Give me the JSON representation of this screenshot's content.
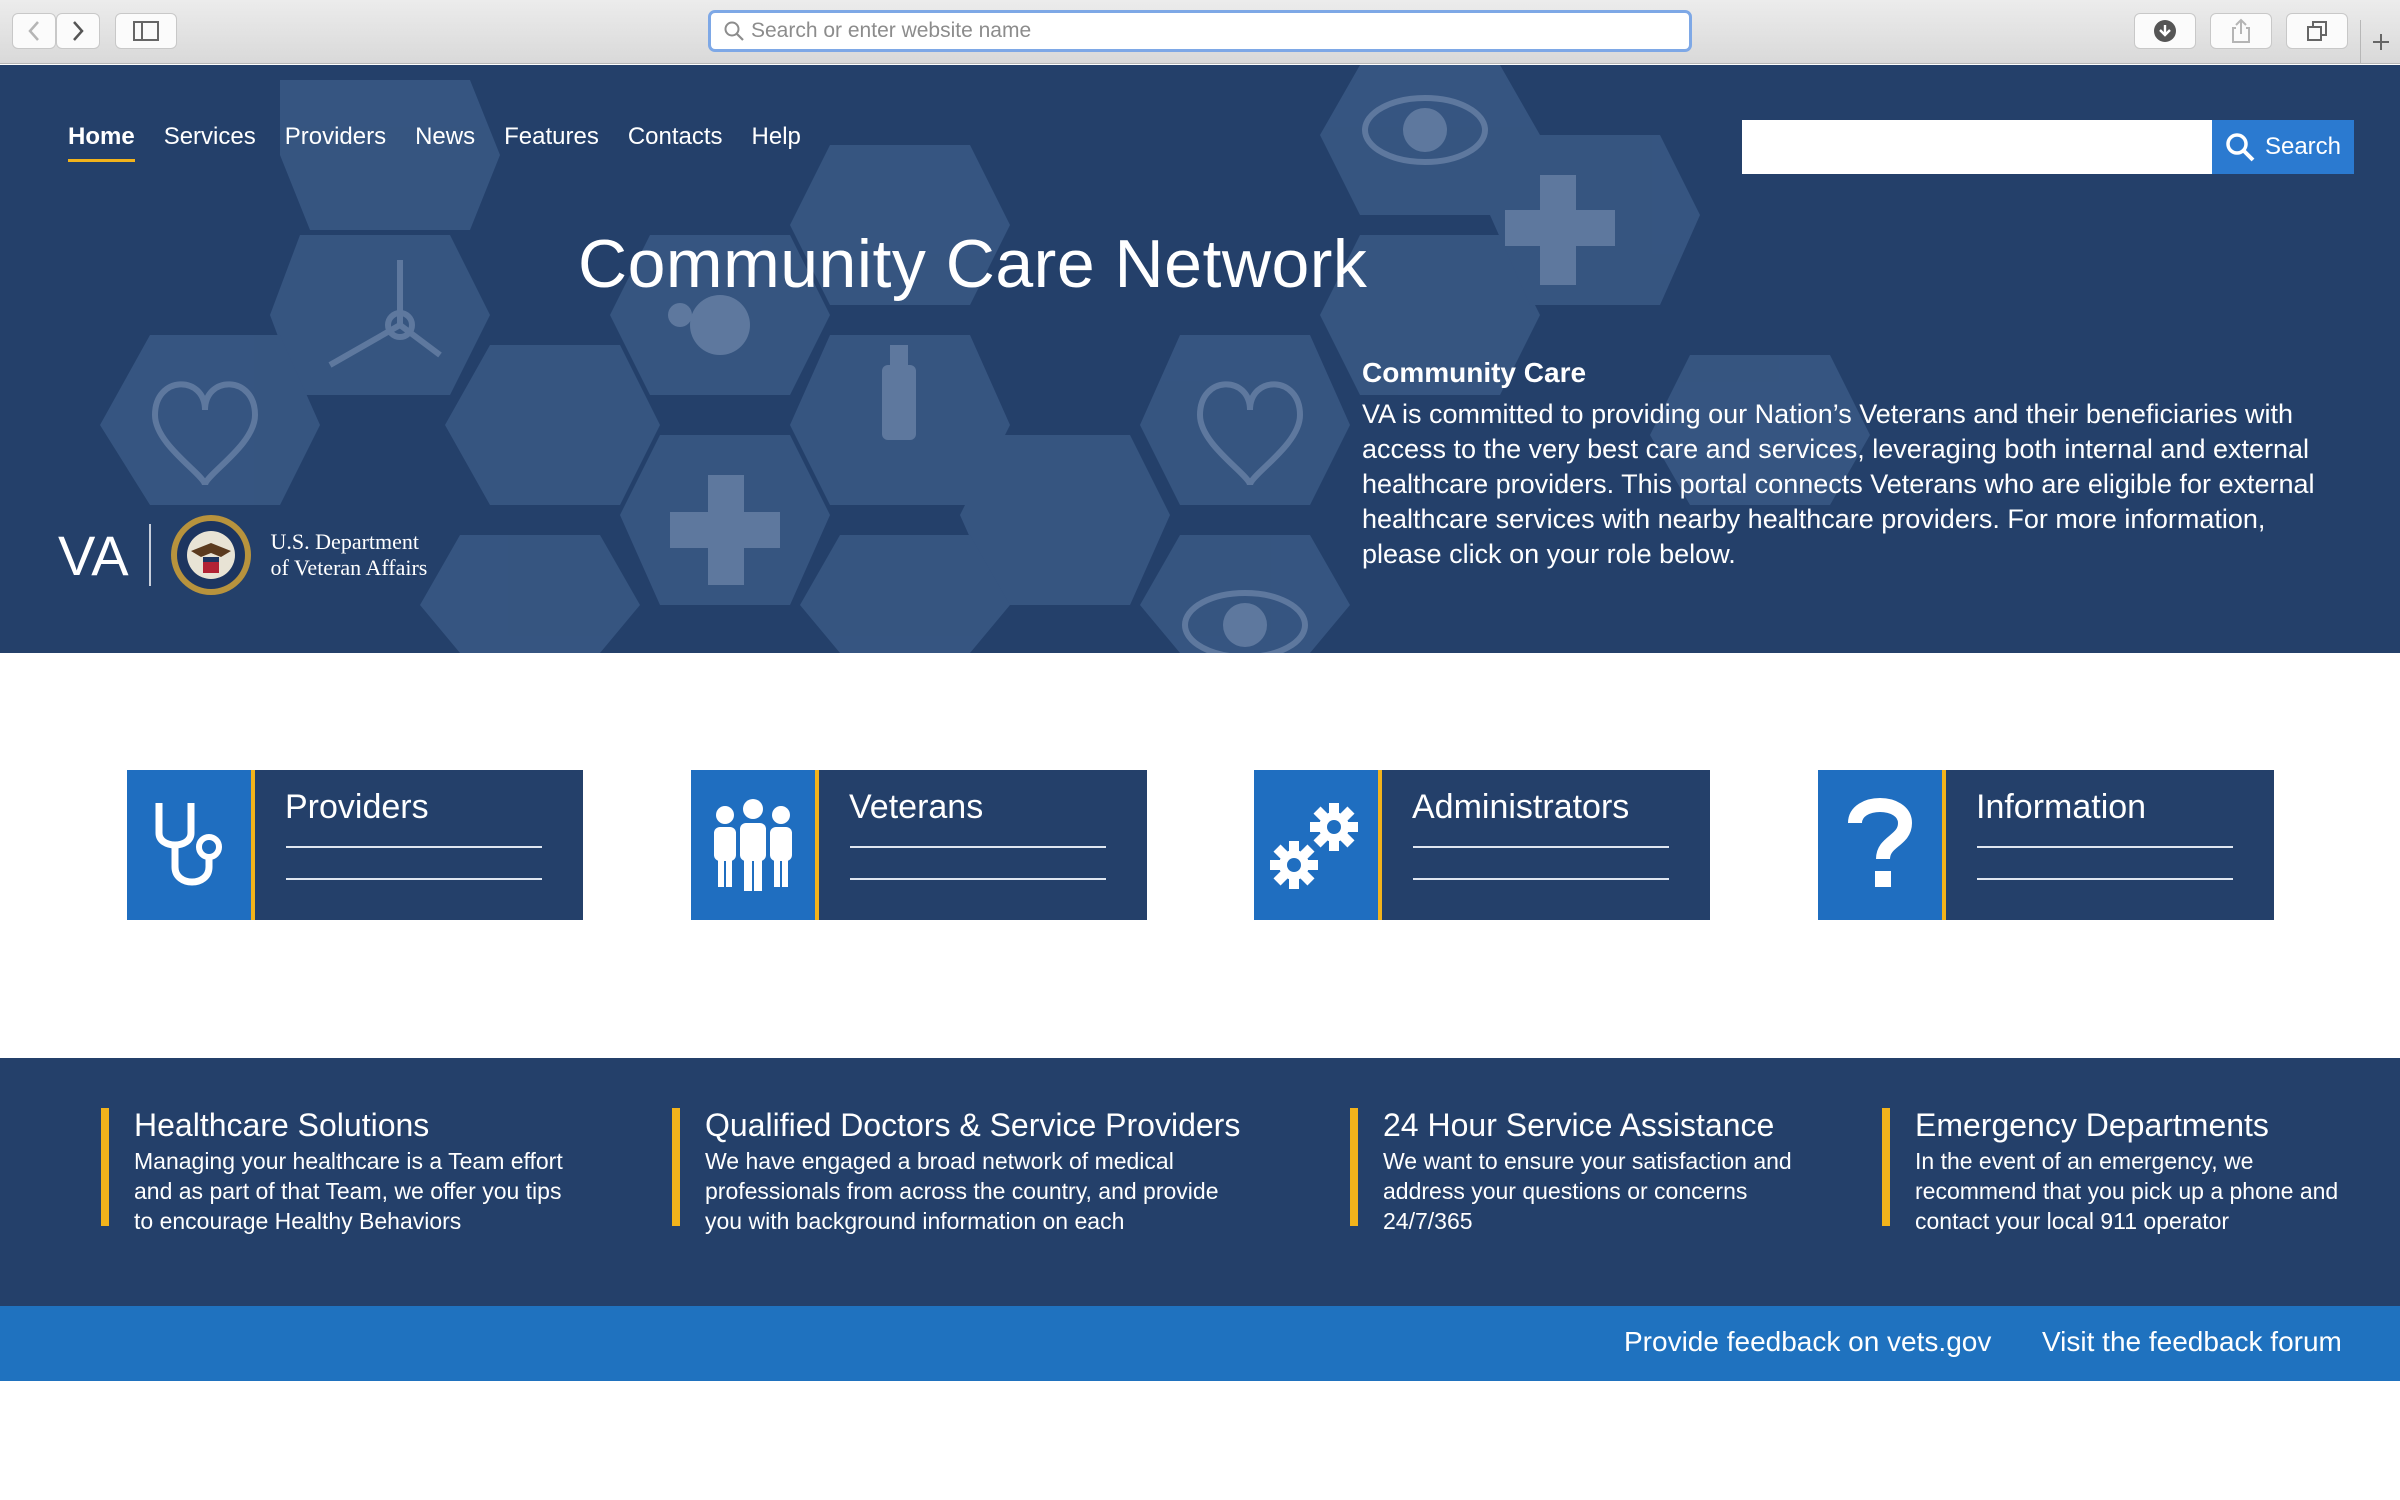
{
  "browser": {
    "address_placeholder": "Search or enter website name",
    "icons": [
      "back-icon",
      "forward-icon",
      "sidebar-icon",
      "download-icon",
      "share-icon",
      "tabs-icon",
      "plus-icon",
      "search-icon"
    ]
  },
  "nav": {
    "items": [
      {
        "label": "Home",
        "active": true
      },
      {
        "label": "Services"
      },
      {
        "label": "Providers"
      },
      {
        "label": "News"
      },
      {
        "label": "Features"
      },
      {
        "label": "Contacts"
      },
      {
        "label": "Help"
      }
    ]
  },
  "header_search": {
    "button_label": "Search",
    "value": ""
  },
  "hero": {
    "title": "Community Care Network",
    "intro_heading": "Community Care",
    "intro_text": "VA is committed to providing our Nation’s Veterans and their beneficiaries with access to the very best care and services, leveraging both internal and external healthcare providers.  This portal connects Veterans who are eligible for external healthcare services with nearby healthcare providers.  For more information, please click on your role below.",
    "logo_mark": "VA",
    "logo_dept_line1": "U.S. Department",
    "logo_dept_line2": "of Veteran Affairs"
  },
  "roles": [
    {
      "label": "Providers",
      "icon": "stethoscope-icon"
    },
    {
      "label": "Veterans",
      "icon": "people-icon"
    },
    {
      "label": "Administrators",
      "icon": "gears-icon"
    },
    {
      "label": "Information",
      "icon": "question-icon"
    }
  ],
  "features": [
    {
      "title": "Healthcare Solutions",
      "text": "Managing your healthcare is a Team effort and as part of that Team, we offer you tips to encourage Healthy Behaviors"
    },
    {
      "title": "Qualified Doctors & Service Providers",
      "text": "We have engaged a broad network of medical professionals from across the country, and provide you with background information on each"
    },
    {
      "title": "24 Hour Service Assistance",
      "text": "We want to ensure your satisfaction and address your  questions or concerns 24/7/365"
    },
    {
      "title": "Emergency Departments",
      "text": "In the event of an emergency, we recommend that you pick up a phone and contact your local 911 operator"
    }
  ],
  "footer": {
    "link1": "Provide feedback on vets.gov",
    "link2": "Visit the feedback forum"
  },
  "colors": {
    "navy": "#24406a",
    "accent_blue": "#1f6ec0",
    "gold": "#f2b31b",
    "footer_blue": "#1f72bf"
  }
}
